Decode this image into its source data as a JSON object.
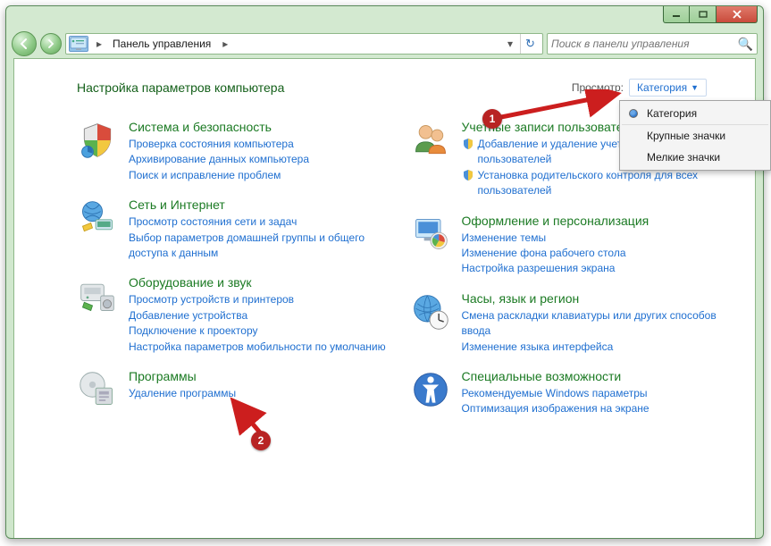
{
  "window": {
    "breadcrumb": "Панель управления",
    "search_placeholder": "Поиск в панели управления"
  },
  "header": {
    "title": "Настройка параметров компьютера",
    "view_label": "Просмотр:",
    "view_value": "Категория"
  },
  "dropdown": {
    "items": [
      "Категория",
      "Крупные значки",
      "Мелкие значки"
    ]
  },
  "left": [
    {
      "title": "Система и безопасность",
      "links": [
        "Проверка состояния компьютера",
        "Архивирование данных компьютера",
        "Поиск и исправление проблем"
      ]
    },
    {
      "title": "Сеть и Интернет",
      "links": [
        "Просмотр состояния сети и задач",
        "Выбор параметров домашней группы и общего доступа к данным"
      ]
    },
    {
      "title": "Оборудование и звук",
      "links": [
        "Просмотр устройств и принтеров",
        "Добавление устройства",
        "Подключение к проектору",
        "Настройка параметров мобильности по умолчанию"
      ]
    },
    {
      "title": "Программы",
      "links": [
        "Удаление программы"
      ]
    }
  ],
  "right": [
    {
      "title": "Учетные записи пользователей и семейн...",
      "shield_links": [
        "Добавление и удаление учетных записей пользователей",
        "Установка родительского контроля для всех пользователей"
      ]
    },
    {
      "title": "Оформление и персонализация",
      "links": [
        "Изменение темы",
        "Изменение фона рабочего стола",
        "Настройка разрешения экрана"
      ]
    },
    {
      "title": "Часы, язык и регион",
      "links": [
        "Смена раскладки клавиатуры или других способов ввода",
        "Изменение языка интерфейса"
      ]
    },
    {
      "title": "Специальные возможности",
      "links": [
        "Рекомендуемые Windows параметры",
        "Оптимизация изображения на экране"
      ]
    }
  ],
  "annotations": {
    "badge1": "1",
    "badge2": "2"
  }
}
